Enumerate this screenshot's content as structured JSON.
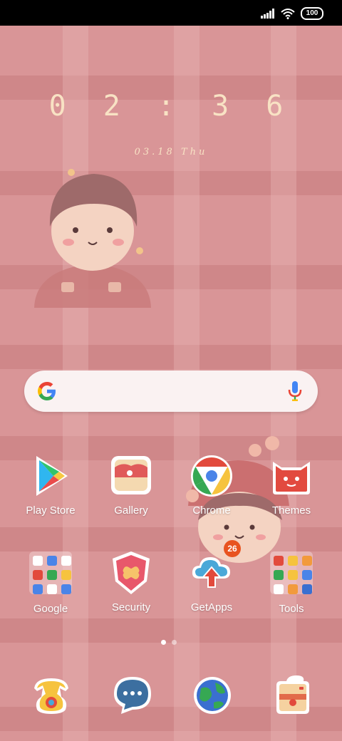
{
  "status_bar": {
    "battery": "100"
  },
  "clock": {
    "time": "0 2 : 3 6",
    "date": "03.18 Thu"
  },
  "search": {
    "placeholder": ""
  },
  "apps": {
    "row1": [
      {
        "label": "Play Store",
        "icon": "play-store-icon"
      },
      {
        "label": "Gallery",
        "icon": "gallery-icon"
      },
      {
        "label": "Chrome",
        "icon": "chrome-icon"
      },
      {
        "label": "Themes",
        "icon": "themes-icon"
      }
    ],
    "row2": [
      {
        "label": "Google",
        "icon": "google-folder-icon"
      },
      {
        "label": "Security",
        "icon": "security-icon"
      },
      {
        "label": "GetApps",
        "icon": "getapps-icon",
        "badge": "26"
      },
      {
        "label": "Tools",
        "icon": "tools-folder-icon"
      }
    ]
  },
  "dock": [
    "phone-icon",
    "messages-icon",
    "browser-icon",
    "camera-icon"
  ],
  "page_indicator": {
    "pages": 2,
    "active": 1
  },
  "colors": {
    "wallpaper": "#d99597",
    "clock_text": "#f8e2c4",
    "badge": "#e8531f"
  }
}
